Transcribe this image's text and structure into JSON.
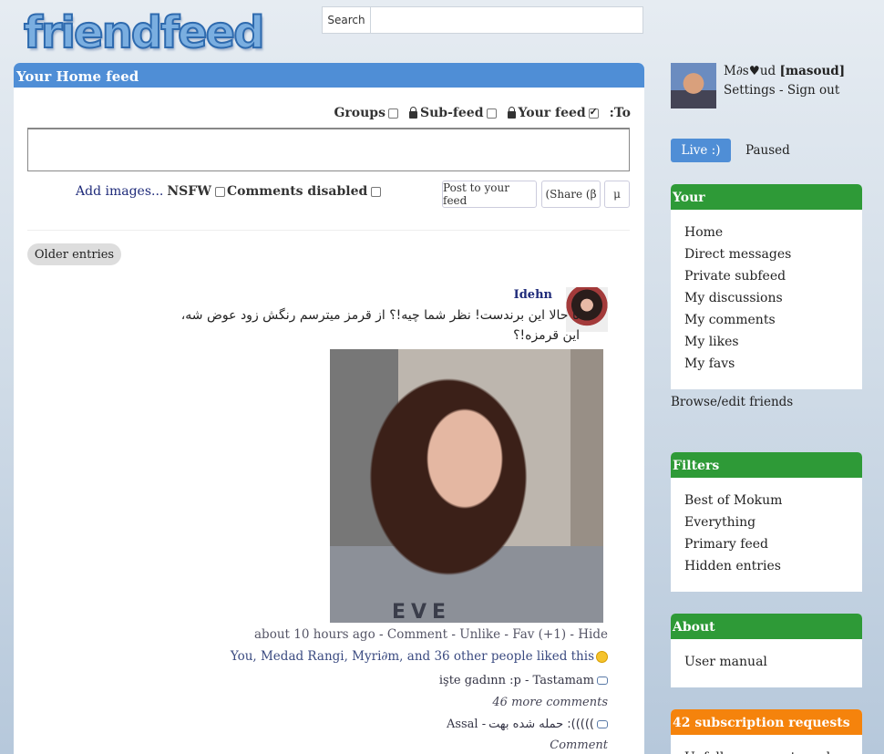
{
  "header": {
    "logo_text": "friendfeed",
    "search_button": "Search",
    "search_placeholder": ""
  },
  "main": {
    "title": "Your Home feed",
    "to_label": ":To",
    "your_feed": "Your feed",
    "sub_feed": "Sub-feed",
    "groups": "Groups",
    "comments_disabled": "Comments disabled",
    "nsfw": "NSFW",
    "add_images": "Add images...",
    "post_button": "Post to your feed",
    "share_button": "(Share (β",
    "mu_button": "μ",
    "older_entries": "Older entries"
  },
  "entry": {
    "author": "Idehn",
    "text": "تا حالا این برندست! نظر شما چیه!؟ از قرمز میترسم رنگش زود عوض شه، این قرمزه!؟",
    "photo_text": "EVE",
    "time": "about 10 hours ago",
    "actions": [
      "Comment",
      "Unlike",
      "Fav (+1)",
      "Hide"
    ],
    "likes": "You, Medad Rangi, Myri∂m, and 36 other people liked this",
    "comment1": "işte gadınn :p - Tastamam",
    "more_comments": "46 more comments",
    "comment2_text": "حمله شده بهت :(((((",
    "comment2_author": "Assal -",
    "comment_link": "Comment"
  },
  "sidebar": {
    "user_display": "M∂s♥ud",
    "user_handle": "[masoud]",
    "settings": "Settings",
    "sign_out": "Sign out",
    "live": "Live :)",
    "paused": "Paused",
    "your_title": "Your",
    "your_items": [
      "Home",
      "Direct messages",
      "Private subfeed",
      "My discussions",
      "My comments",
      "My likes",
      "My favs"
    ],
    "browse": "Browse/edit friends",
    "filters_title": "Filters",
    "filter_items": [
      "Best of Mokum",
      "Everything",
      "Primary feed",
      "Hidden entries"
    ],
    "about_title": "About",
    "about_items": [
      "User manual"
    ],
    "requests_title": "42 subscription requests",
    "requests_item": "Unfollow requests and ..."
  }
}
